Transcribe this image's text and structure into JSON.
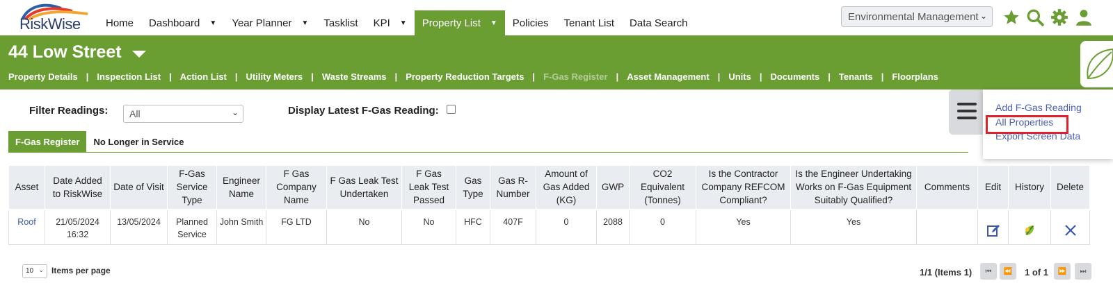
{
  "brand": {
    "name": "RiskWise"
  },
  "nav": {
    "items": [
      {
        "label": "Home",
        "dropdown": false
      },
      {
        "label": "Dashboard",
        "dropdown": true
      },
      {
        "label": "Year Planner",
        "dropdown": true
      },
      {
        "label": "Tasklist",
        "dropdown": false
      },
      {
        "label": "KPI",
        "dropdown": true
      },
      {
        "label": "Property List",
        "dropdown": true,
        "active": true
      },
      {
        "label": "Policies",
        "dropdown": false
      },
      {
        "label": "Tenant List",
        "dropdown": false
      },
      {
        "label": "Data Search",
        "dropdown": false
      }
    ],
    "module_select": "Environmental Management",
    "icons": [
      "star-icon",
      "search-icon",
      "gear-icon",
      "user-icon"
    ]
  },
  "property": {
    "title": "44 Low Street",
    "subnav": [
      {
        "label": "Property Details"
      },
      {
        "label": "Inspection List"
      },
      {
        "label": "Action List"
      },
      {
        "label": "Utility Meters"
      },
      {
        "label": "Waste Streams"
      },
      {
        "label": "Property Reduction Targets"
      },
      {
        "label": "F-Gas Register",
        "current": true
      },
      {
        "label": "Asset Management"
      },
      {
        "label": "Units"
      },
      {
        "label": "Documents"
      },
      {
        "label": "Tenants"
      },
      {
        "label": "Floorplans"
      }
    ]
  },
  "filters": {
    "readings_label": "Filter Readings:",
    "readings_value": "All",
    "latest_label": "Display Latest F-Gas Reading:"
  },
  "tabs": [
    {
      "label": "F-Gas Register",
      "active": true
    },
    {
      "label": "No Longer in Service",
      "active": false
    }
  ],
  "menu": {
    "items": [
      "Add F-Gas Reading",
      "All Properties",
      "Export Screen Data"
    ]
  },
  "table": {
    "headers": [
      "Asset",
      "Date Added to RiskWise",
      "Date of Visit",
      "F-Gas Service Type",
      "Engineer Name",
      "F Gas Company Name",
      "F Gas Leak Test Undertaken",
      "F Gas Leak Test Passed",
      "Gas Type",
      "Gas R-Number",
      "Amount of Gas Added (KG)",
      "GWP",
      "CO2 Equivalent (Tonnes)",
      "Is the Contractor Company REFCOM Compliant?",
      "Is the Engineer Undertaking Works on F-Gas Equipment Suitably Qualified?",
      "Comments",
      "Edit",
      "History",
      "Delete"
    ],
    "rows": [
      {
        "asset": "Roof",
        "date_added": "21/05/2024 16:32",
        "date_visit": "13/05/2024",
        "service_type": "Planned Service",
        "engineer": "John Smith",
        "company": "FG LTD",
        "leak_test": "No",
        "leak_passed": "No",
        "gas_type": "HFC",
        "r_number": "407F",
        "amount": "0",
        "gwp": "2088",
        "co2": "0",
        "refcom": "Yes",
        "qualified": "Yes",
        "comments": ""
      }
    ]
  },
  "pager": {
    "per_page": "10",
    "per_page_label": "Items per page",
    "info": "1/1 (Items 1)",
    "count": "1 of 1"
  }
}
